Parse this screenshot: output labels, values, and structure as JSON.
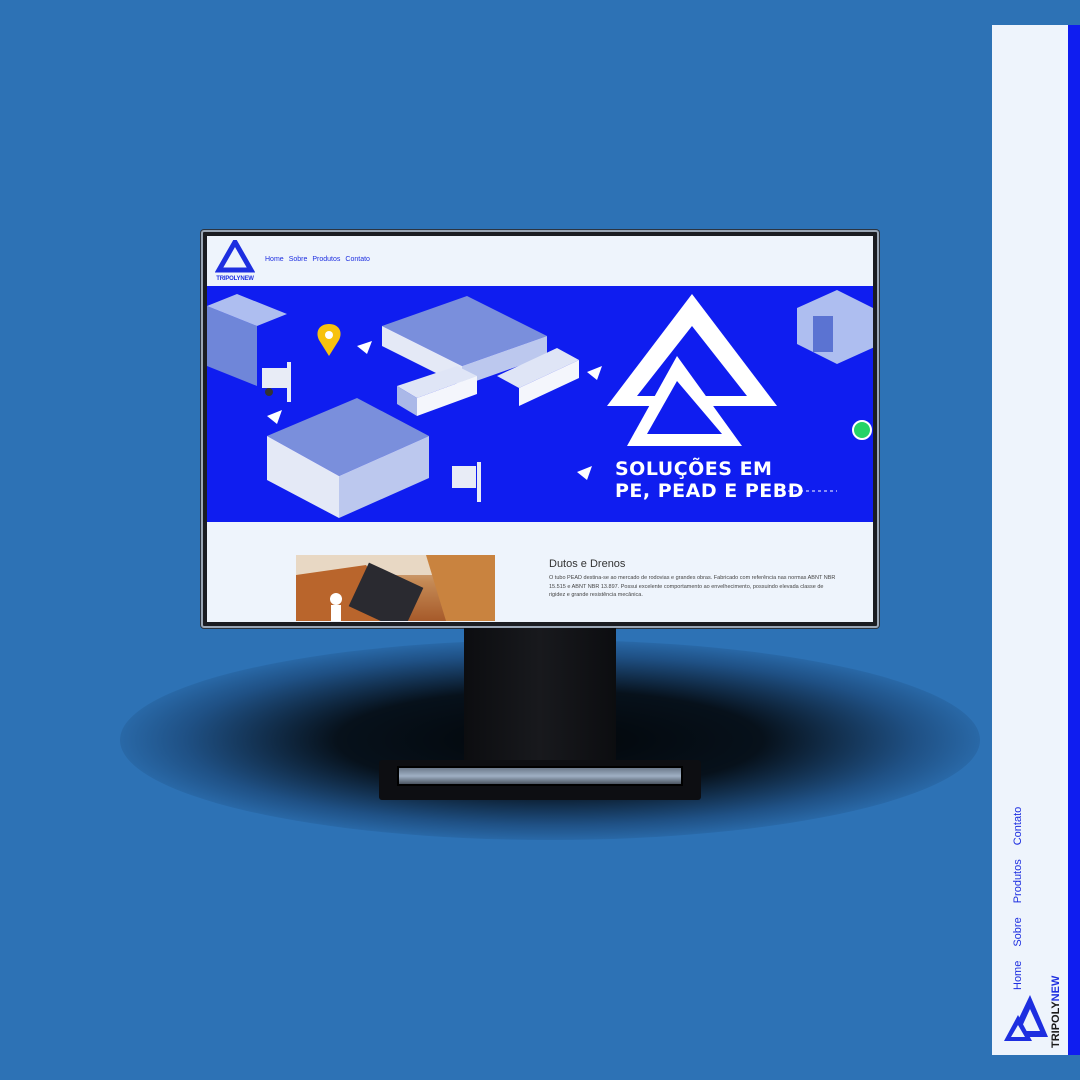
{
  "site": {
    "logo_text": "TRIPOLYNEW",
    "nav": [
      "Home",
      "Sobre",
      "Produtos",
      "Contato"
    ]
  },
  "hero": {
    "title_line1": "SOLUÇÕES EM",
    "title_line2": "PE, PEAD E PEBD"
  },
  "section": {
    "title": "Dutos e Drenos",
    "text": "O tubo PEAD destina-se ao mercado de rodovias e grandes obras. Fabricado com referência nas normas ABNT NBR 15.515 e ABNT NBR 13.897. Possui excelente comportamento ao envelhecimento, possuindo elevada classe de rigidez e grande resistência mecânica."
  },
  "side_panel": {
    "nav": [
      "Home",
      "Sobre",
      "Produtos",
      "Contato"
    ],
    "logo_part1": "TRIPOLY",
    "logo_part2": "NEW"
  },
  "colors": {
    "background": "#2d72b5",
    "brand_blue": "#0f1df0",
    "page_bg": "#eef4fc",
    "whatsapp": "#25d366"
  }
}
